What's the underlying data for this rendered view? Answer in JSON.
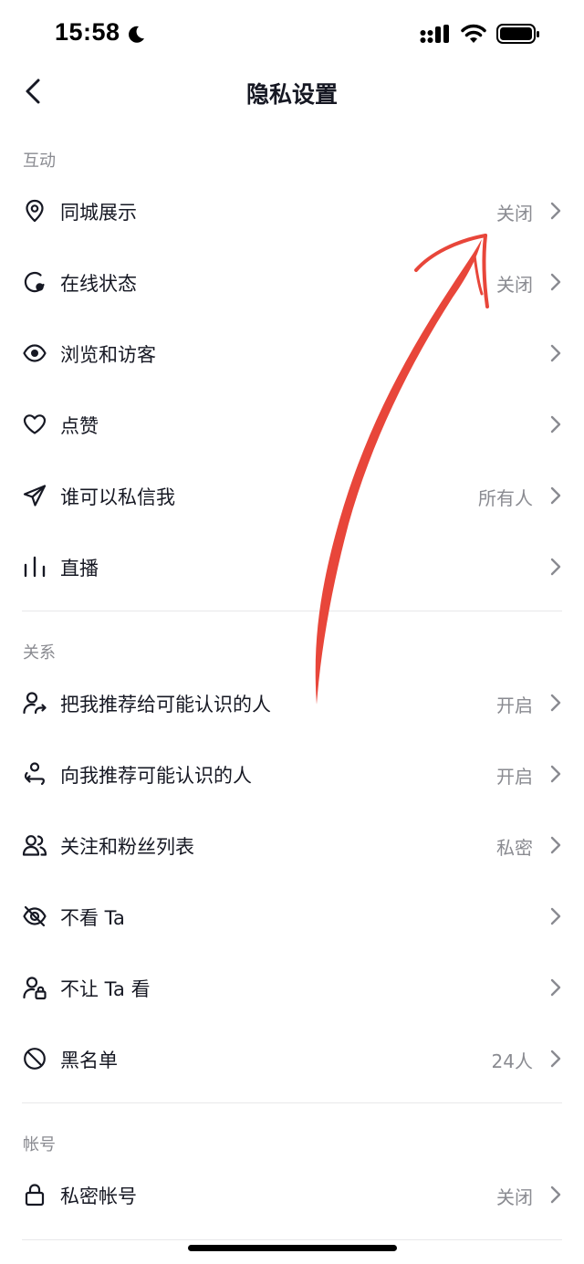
{
  "status_bar": {
    "time": "15:58"
  },
  "nav": {
    "title": "隐私设置"
  },
  "sections": {
    "interaction": {
      "header": "互动",
      "items": [
        {
          "label": "同城展示",
          "value": "关闭",
          "icon": "location-pin-icon"
        },
        {
          "label": "在线状态",
          "value": "关闭",
          "icon": "online-status-icon"
        },
        {
          "label": "浏览和访客",
          "value": "",
          "icon": "eye-icon"
        },
        {
          "label": "点赞",
          "value": "",
          "icon": "heart-icon"
        },
        {
          "label": "谁可以私信我",
          "value": "所有人",
          "icon": "paper-plane-icon"
        },
        {
          "label": "直播",
          "value": "",
          "icon": "live-bars-icon"
        }
      ]
    },
    "relations": {
      "header": "关系",
      "items": [
        {
          "label": "把我推荐给可能认识的人",
          "value": "开启",
          "icon": "user-share-icon"
        },
        {
          "label": "向我推荐可能认识的人",
          "value": "开启",
          "icon": "user-recommend-icon"
        },
        {
          "label": "关注和粉丝列表",
          "value": "私密",
          "icon": "users-icon"
        },
        {
          "label": "不看 Ta",
          "value": "",
          "icon": "eye-off-icon"
        },
        {
          "label": "不让 Ta 看",
          "value": "",
          "icon": "user-lock-icon"
        },
        {
          "label": "黑名单",
          "value": "24人",
          "icon": "block-icon"
        }
      ]
    },
    "account": {
      "header": "帐号",
      "items": [
        {
          "label": "私密帐号",
          "value": "关闭",
          "icon": "lock-icon"
        }
      ]
    }
  },
  "colors": {
    "text_primary": "#161823",
    "text_secondary": "#8a8b91",
    "annotation_arrow": "#e8463a"
  }
}
